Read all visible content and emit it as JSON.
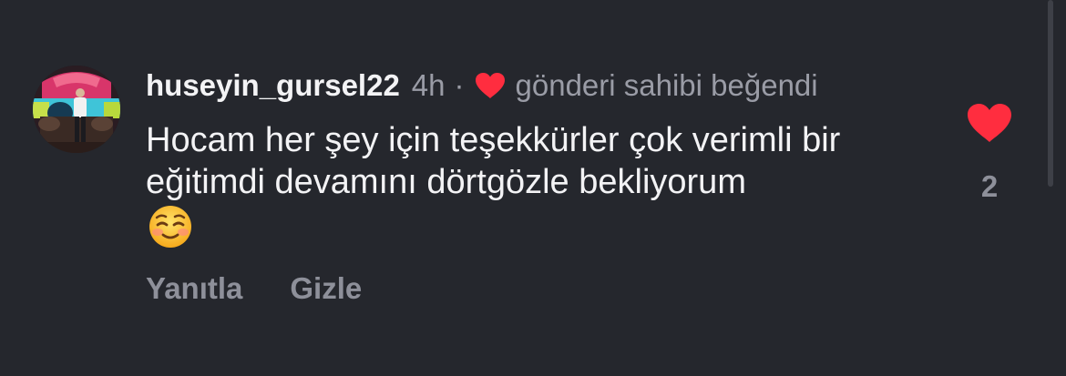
{
  "comment": {
    "username": "huseyin_gursel22",
    "time": "4h",
    "separator": "·",
    "liked_by_author_text": "gönderi sahibi beğendi",
    "body_text": "Hocam her şey için teşekkürler çok verimli bir eğitimdi devamını dörtgözle bekliyorum",
    "emoji": "☺️",
    "actions": {
      "reply_label": "Yanıtla",
      "hide_label": "Gizle"
    },
    "like_count": "2",
    "liked": true
  },
  "colors": {
    "background": "#25272d",
    "primary_text": "#f3f3f5",
    "secondary_text": "#9a9ca6",
    "heart": "#ff2d3f"
  },
  "icons": {
    "avatar": "profile-photo",
    "small_heart": "heart-icon",
    "like": "heart-filled-icon",
    "emoji": "smiling-face-emoji"
  }
}
